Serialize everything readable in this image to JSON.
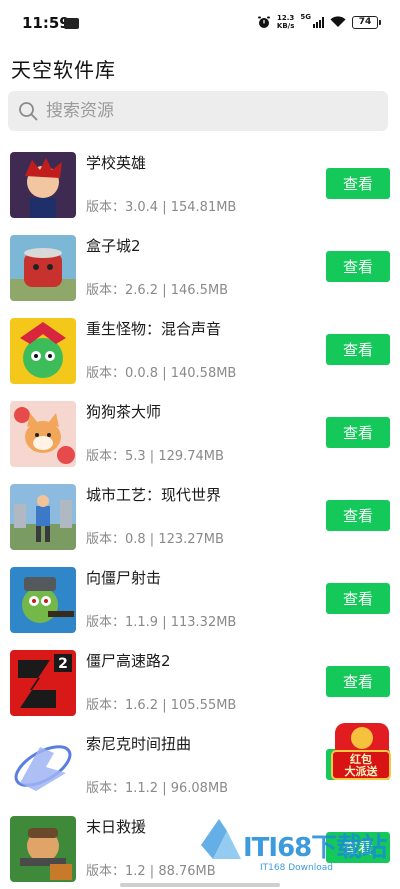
{
  "status_bar": {
    "time": "11:59",
    "speed_value": "12.3",
    "speed_unit": "KB/s",
    "network": "5G",
    "battery": "74"
  },
  "header": {
    "title": "天空软件库"
  },
  "search": {
    "placeholder": "搜索资源"
  },
  "apps": [
    {
      "name": "学校英雄",
      "meta": "版本：3.0.4 | 154.81MB",
      "button": "查看"
    },
    {
      "name": "盒子城2",
      "meta": "版本：2.6.2 | 146.5MB",
      "button": "查看"
    },
    {
      "name": "重生怪物：混合声音",
      "meta": "版本：0.0.8 | 140.58MB",
      "button": "查看"
    },
    {
      "name": "狗狗茶大师",
      "meta": "版本：5.3 | 129.74MB",
      "button": "查看"
    },
    {
      "name": "城市工艺：现代世界",
      "meta": "版本：0.8 | 123.27MB",
      "button": "查看"
    },
    {
      "name": "向僵尸射击",
      "meta": "版本：1.1.9 | 113.32MB",
      "button": "查看"
    },
    {
      "name": "僵尸高速路2",
      "meta": "版本：1.6.2 | 105.55MB",
      "button": "查看"
    },
    {
      "name": "索尼克时间扭曲",
      "meta": "版本：1.1.2 | 96.08MB",
      "button": "查看"
    },
    {
      "name": "末日救援",
      "meta": "版本：1.2 | 88.76MB",
      "button": "查看"
    }
  ],
  "red_packet": {
    "line1": "红包",
    "line2": "大派送"
  },
  "watermark": {
    "brand": "ITI68下载站",
    "sub": "IT168 Download"
  },
  "colors": {
    "accent_green": "#14c95a",
    "search_bg": "#ededed",
    "meta_gray": "#8a8a8a"
  }
}
